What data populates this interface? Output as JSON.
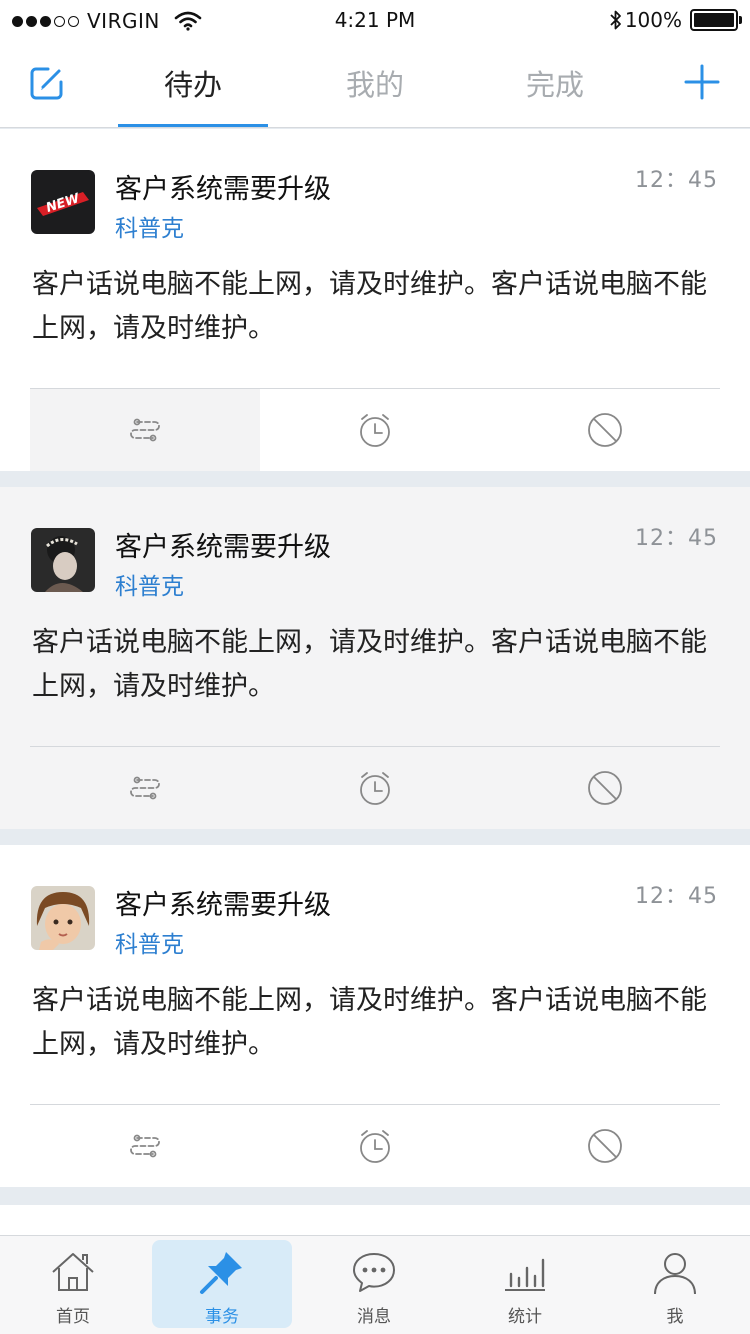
{
  "status_bar": {
    "carrier": "VIRGIN",
    "time": "4:21 PM",
    "battery": "100%"
  },
  "top_nav": {
    "compose_icon": "compose-icon",
    "add_icon": "plus-icon",
    "tabs": [
      {
        "label": "待办",
        "active": true
      },
      {
        "label": "我的",
        "active": false
      },
      {
        "label": "完成",
        "active": false
      }
    ],
    "accent_color": "#2b90e6"
  },
  "cards": [
    {
      "title": "客户系统需要升级",
      "author": "科普克",
      "time": "12：45",
      "body": "客户话说电脑不能上网，请及时维护。客户话说电脑不能上网，请及时维护。",
      "avatar": "new-badge-avatar"
    },
    {
      "title": "客户系统需要升级",
      "author": "科普克",
      "time": "12：45",
      "body": "客户话说电脑不能上网，请及时维护。客户话说电脑不能上网，请及时维护。",
      "avatar": "woman-photo-avatar"
    },
    {
      "title": "客户系统需要升级",
      "author": "科普克",
      "time": "12：45",
      "body": "客户话说电脑不能上网，请及时维护。客户话说电脑不能上网，请及时维护。",
      "avatar": "child-photo-avatar"
    }
  ],
  "card_actions": [
    "transfer-icon",
    "alarm-clock-icon",
    "forbid-icon"
  ],
  "tabbar": {
    "items": [
      {
        "label": "首页",
        "icon": "home-icon",
        "active": false
      },
      {
        "label": "事务",
        "icon": "pin-icon",
        "active": true
      },
      {
        "label": "消息",
        "icon": "chat-icon",
        "active": false
      },
      {
        "label": "统计",
        "icon": "bar-chart-icon",
        "active": false
      },
      {
        "label": "我",
        "icon": "user-icon",
        "active": false
      }
    ]
  }
}
